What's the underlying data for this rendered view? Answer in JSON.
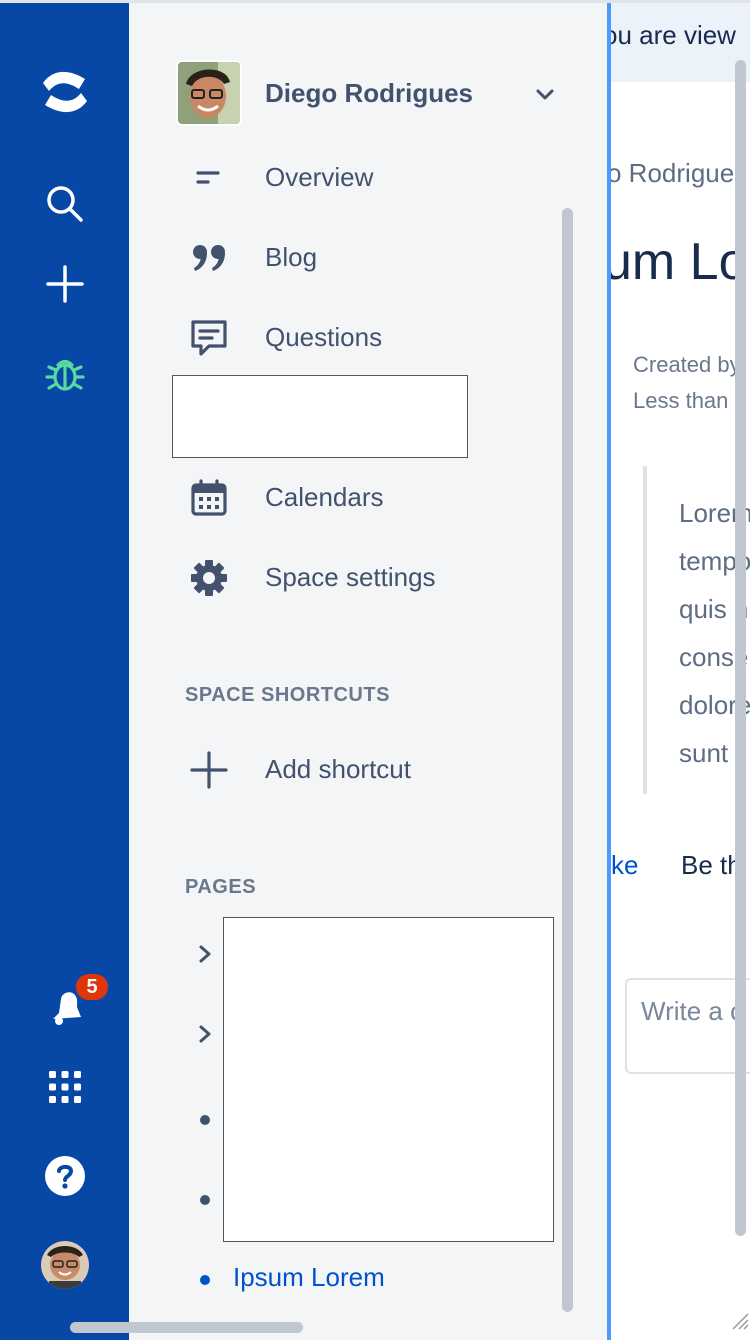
{
  "global_nav": {
    "notification_count": "5",
    "icons": [
      "confluence-logo-icon",
      "search-icon",
      "create-icon",
      "bug-icon",
      "notifications-icon",
      "app-switcher-icon",
      "help-icon",
      "profile-avatar"
    ]
  },
  "sidebar": {
    "space_name": "Diego Rodrigues",
    "items": [
      {
        "label": "Overview",
        "icon": "overview-icon"
      },
      {
        "label": "Blog",
        "icon": "quote-icon"
      },
      {
        "label": "Questions",
        "icon": "questions-icon"
      },
      {
        "label": "Calendars",
        "icon": "calendar-icon"
      },
      {
        "label": "Space settings",
        "icon": "gear-icon"
      }
    ],
    "shortcuts_heading": "SPACE SHORTCUTS",
    "add_shortcut_label": "Add shortcut",
    "pages_heading": "PAGES",
    "current_page": "Ipsum Lorem"
  },
  "main": {
    "banner_text": "ou are view",
    "breadcrumb": "o Rodrigue",
    "title": "um Lo",
    "byline_1": "Created by",
    "byline_2": "Less than",
    "quote_lines": [
      "Lorem",
      "tempo",
      "quis n",
      "conse",
      "dolore",
      "sunt i"
    ],
    "like_label": "ke",
    "be_first": "Be th",
    "comment_placeholder": "Write a c"
  },
  "colors": {
    "global_nav_bg": "#0747a6",
    "sidebar_bg": "#f4f5f7",
    "link": "#0052cc",
    "badge": "#de350b",
    "divider": "#4c9aff"
  }
}
